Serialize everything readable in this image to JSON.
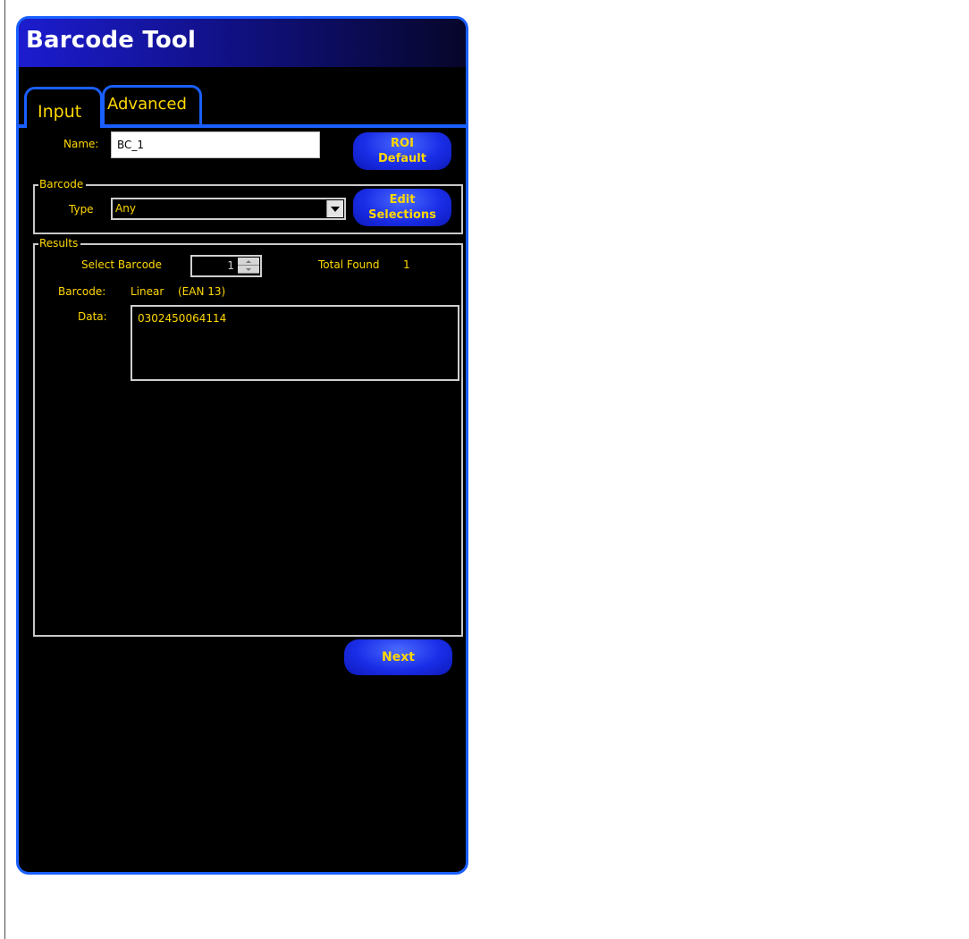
{
  "window": {
    "title": "Barcode Tool"
  },
  "tabs": [
    {
      "label": "Input",
      "active": true
    },
    {
      "label": "Advanced",
      "active": false
    }
  ],
  "name_field": {
    "label": "Name:",
    "value": "BC_1"
  },
  "roi_button": {
    "line1": "ROI",
    "line2": "Default"
  },
  "barcode_group": {
    "legend": "Barcode",
    "type_label": "Type",
    "type_value": "Any",
    "edit_button_line1": "Edit",
    "edit_button_line2": "Selections"
  },
  "results_group": {
    "legend": "Results",
    "select_label": "Select Barcode",
    "select_value": "1",
    "total_found_label": "Total Found",
    "total_found_value": "1",
    "barcode_label": "Barcode:",
    "barcode_type": "Linear",
    "barcode_symbology": "(EAN 13)",
    "data_label": "Data:",
    "data_value": "0302450064114"
  },
  "next_button": {
    "label": "Next"
  },
  "colors": {
    "accent": "#1a5fff",
    "text": "#ffd800",
    "background": "#000000",
    "title_gradient_start": "#1c1ccf"
  }
}
